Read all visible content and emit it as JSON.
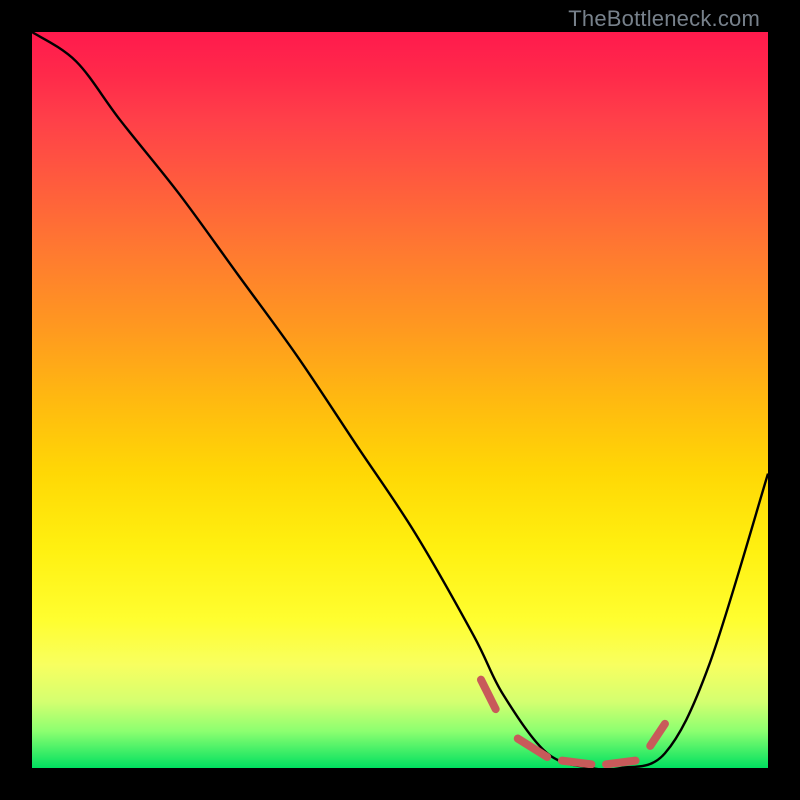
{
  "watermark": "TheBottleneck.com",
  "chart_data": {
    "type": "line",
    "title": "",
    "xlabel": "",
    "ylabel": "",
    "xlim": [
      0,
      100
    ],
    "ylim": [
      0,
      100
    ],
    "series": [
      {
        "name": "bottleneck-curve",
        "x": [
          0,
          6,
          12,
          20,
          28,
          36,
          44,
          52,
          60,
          64,
          70,
          76,
          80,
          86,
          92,
          100
        ],
        "y": [
          100,
          96,
          88,
          78,
          67,
          56,
          44,
          32,
          18,
          10,
          2,
          0,
          0,
          2,
          14,
          40
        ]
      }
    ],
    "highlight": {
      "name": "trough-dashes",
      "segments": [
        {
          "x1": 61,
          "y1": 12,
          "x2": 63,
          "y2": 8
        },
        {
          "x1": 66,
          "y1": 4,
          "x2": 70,
          "y2": 1.5
        },
        {
          "x1": 72,
          "y1": 1,
          "x2": 76,
          "y2": 0.5
        },
        {
          "x1": 78,
          "y1": 0.5,
          "x2": 82,
          "y2": 1
        },
        {
          "x1": 84,
          "y1": 3,
          "x2": 86,
          "y2": 6
        }
      ]
    },
    "gradient_stops": [
      {
        "pos": 0,
        "color": "#ff1a4d"
      },
      {
        "pos": 50,
        "color": "#ffb910"
      },
      {
        "pos": 80,
        "color": "#fffe30"
      },
      {
        "pos": 100,
        "color": "#00e060"
      }
    ]
  }
}
